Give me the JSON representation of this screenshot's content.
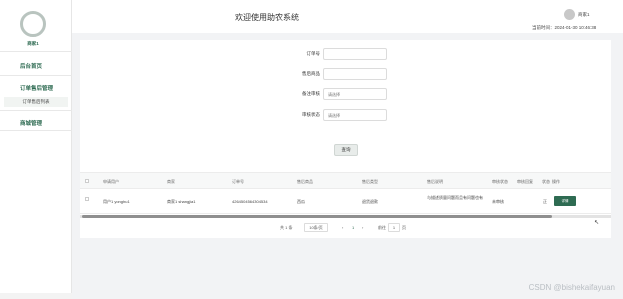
{
  "app": {
    "title": "欢迎使用助农系统"
  },
  "header": {
    "user_name": "商家1",
    "time_text": "当前时间：2024-01-30 10:46:38"
  },
  "sidebar": {
    "username": "商家1",
    "items": [
      {
        "label": "后台首页"
      },
      {
        "label": "订单售后管理"
      },
      {
        "label": "订单售后列表"
      },
      {
        "label": "商城管理"
      }
    ]
  },
  "search": {
    "fields": [
      {
        "label": "订单号",
        "value": "",
        "placeholder": ""
      },
      {
        "label": "售后商品",
        "value": "",
        "placeholder": ""
      },
      {
        "label": "备注审核",
        "value": "",
        "placeholder": "请选择"
      },
      {
        "label": "审核状态",
        "value": "",
        "placeholder": "请选择"
      }
    ],
    "query_label": "查询"
  },
  "table": {
    "columns": [
      "申请用户",
      "商家",
      "订单号",
      "售后商品",
      "售后类型",
      "售后说明",
      "审核状态",
      "审核回复",
      "状态",
      "操作"
    ],
    "rows": [
      {
        "user": "用户1 yonghu1",
        "merchant": "商家1 shangjia1",
        "order_no": "4264504564304534",
        "product": "西瓜",
        "type": "退货退款",
        "description": "与描述质量问题而且有问题也有",
        "audit_status": "未审核",
        "audit_reply": "",
        "state": "正",
        "action": "详情"
      }
    ]
  },
  "pagination": {
    "total": "共 1 条",
    "page_size": "10条/页",
    "prev": "‹",
    "page": "1",
    "next": "›",
    "goto_label": "前往",
    "goto_value": "1",
    "goto_suffix": "页"
  },
  "watermark": "CSDN @bishekaifayuan"
}
